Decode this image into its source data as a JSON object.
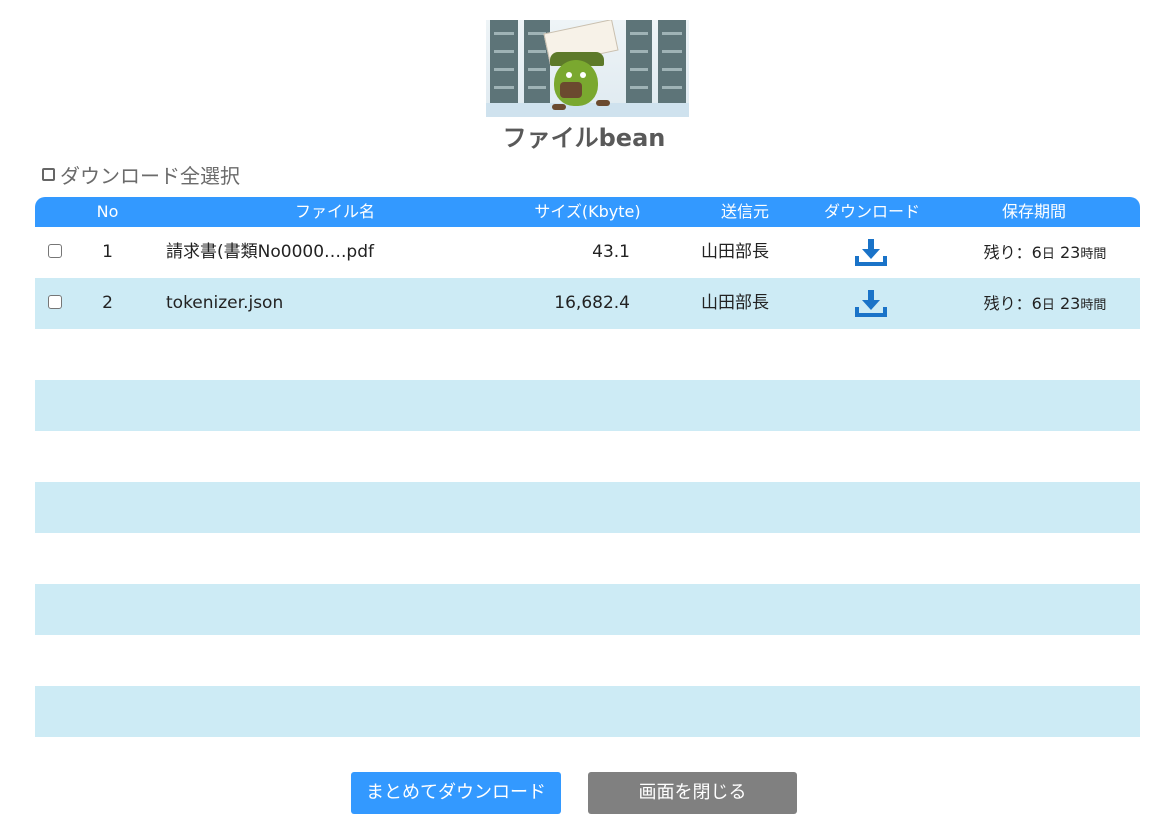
{
  "app": {
    "title": "ファイルbean"
  },
  "select_all": {
    "label": "ダウンロード全選択"
  },
  "table": {
    "headers": {
      "no": "No",
      "filename": "ファイル名",
      "size": "サイズ(Kbyte)",
      "sender": "送信元",
      "download": "ダウンロード",
      "retention": "保存期間"
    },
    "rows": [
      {
        "no": "1",
        "filename": "請求書(書類No0000….pdf",
        "size": "43.1",
        "sender": "山田部長",
        "days": "残り：6",
        "day_unit": "日",
        "hours": " 23",
        "hour_unit": "時間"
      },
      {
        "no": "2",
        "filename": "tokenizer.json",
        "size": "16,682.4",
        "sender": "山田部長",
        "days": "残り：6",
        "day_unit": "日",
        "hours": " 23",
        "hour_unit": "時間"
      }
    ]
  },
  "buttons": {
    "download_all": "まとめてダウンロード",
    "close": "画面を閉じる"
  },
  "colors": {
    "accent": "#3399ff",
    "row_alt": "#cdebf5",
    "close_button": "#808080",
    "download_icon": "#1a73c8"
  },
  "icons": {
    "download": "download-icon",
    "checkbox": "checkbox-icon"
  }
}
